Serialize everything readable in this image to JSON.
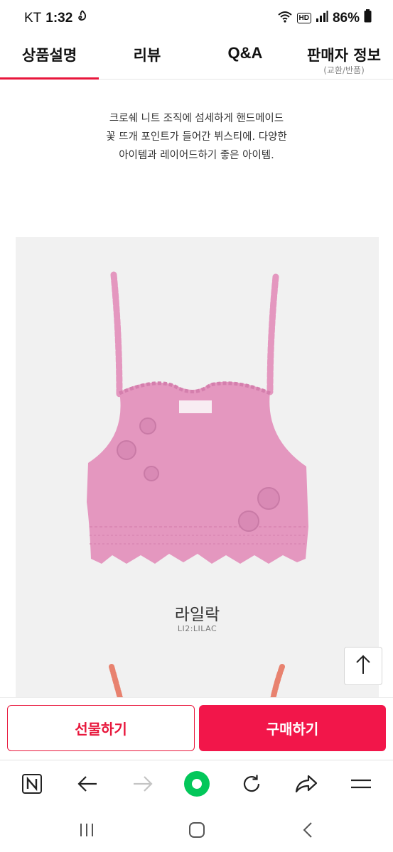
{
  "status_bar": {
    "carrier": "KT",
    "time": "1:32",
    "hd_badge": "HD",
    "battery": "86%",
    "icons": [
      "notification-icon",
      "wifi-icon",
      "signal-icon",
      "battery-icon"
    ]
  },
  "tabs": [
    {
      "label": "상품설명",
      "active": true
    },
    {
      "label": "리뷰"
    },
    {
      "label": "Q&A"
    },
    {
      "label": "판매자 정보",
      "sub": "(교환/반품)"
    }
  ],
  "description": {
    "lines": [
      "크로쉐 니트 조직에 섬세하게 핸드메이드",
      "꽃 뜨개 포인트가 들어간 뷔스티에. 다양한",
      "아이템과 레이어드하기 좋은 아이템."
    ]
  },
  "product": {
    "color_name": "라일락",
    "color_code": "LI2:LILAC"
  },
  "purchase": {
    "gift_label": "선물하기",
    "buy_label": "구매하기"
  },
  "colors": {
    "accent": "#e8173c",
    "buy_button": "#f2164a",
    "garment": "#e497bf",
    "next_garment": "#e8826f",
    "naver_green": "#03c75a"
  },
  "browser_toolbar": {
    "icons": [
      "naver-icon",
      "back-arrow-icon",
      "forward-arrow-icon",
      "home-circle-icon",
      "refresh-icon",
      "share-icon",
      "menu-icon"
    ]
  },
  "system_nav": {
    "icons": [
      "recent-apps-icon",
      "home-icon",
      "back-icon"
    ]
  }
}
